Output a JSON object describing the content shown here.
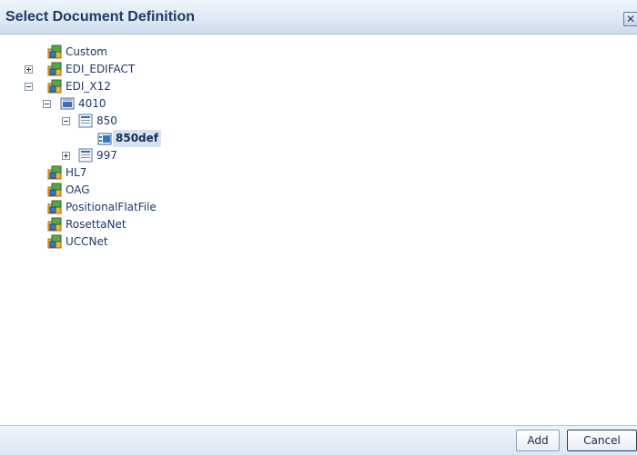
{
  "dialog": {
    "title": "Select Document Definition",
    "close_symbol": "✕"
  },
  "tree": {
    "nodes": [
      {
        "label": "Custom",
        "icon": "package-icon"
      },
      {
        "label": "EDI_EDIFACT",
        "icon": "package-icon",
        "toggle": "expand"
      },
      {
        "label": "EDI_X12",
        "icon": "package-icon",
        "toggle": "collapse"
      },
      {
        "label": "4010",
        "icon": "version-icon",
        "toggle": "collapse"
      },
      {
        "label": "850",
        "icon": "document-type-icon",
        "toggle": "collapse"
      },
      {
        "label": "850def",
        "icon": "definition-icon",
        "selected": true
      },
      {
        "label": "997",
        "icon": "document-type-icon",
        "toggle": "expand"
      },
      {
        "label": "HL7",
        "icon": "package-icon"
      },
      {
        "label": "OAG",
        "icon": "package-icon"
      },
      {
        "label": "PositionalFlatFile",
        "icon": "package-icon"
      },
      {
        "label": "RosettaNet",
        "icon": "package-icon"
      },
      {
        "label": "UCCNet",
        "icon": "package-icon"
      }
    ]
  },
  "footer": {
    "add_label": "Add",
    "cancel_label": "Cancel"
  },
  "colors": {
    "title_text": "#1f3a64",
    "selected_bg": "#d6e2f1",
    "label_text": "#1a3a6a"
  }
}
